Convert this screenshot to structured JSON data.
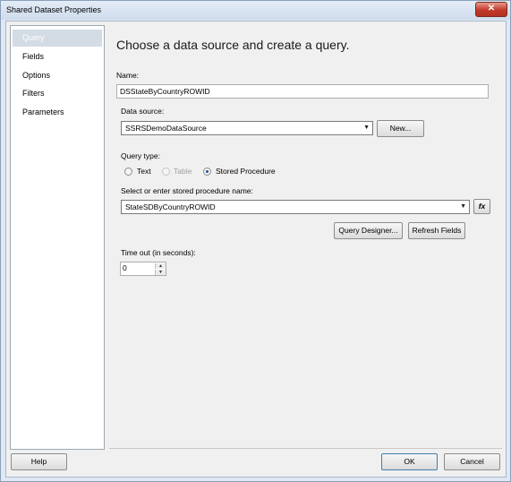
{
  "window": {
    "title": "Shared Dataset Properties",
    "close_glyph": "✕"
  },
  "sidebar": {
    "items": [
      {
        "label": "Query",
        "active": true
      },
      {
        "label": "Fields"
      },
      {
        "label": "Options"
      },
      {
        "label": "Filters"
      },
      {
        "label": "Parameters"
      }
    ]
  },
  "main": {
    "heading": "Choose a data source and create a query.",
    "name_label": "Name:",
    "name_value": "DSStateByCountryROWID",
    "datasource_label": "Data source:",
    "datasource_value": "SSRSDemoDataSource",
    "new_button": "New...",
    "querytype_label": "Query type:",
    "querytype_options": [
      "Text",
      "Table",
      "Stored Procedure"
    ],
    "querytype_selected": "Stored Procedure",
    "sp_label": "Select or enter stored procedure name:",
    "sp_value": "StateSDByCountryROWID",
    "fx_button": "fx",
    "query_designer_button": "Query Designer...",
    "refresh_fields_button": "Refresh Fields",
    "timeout_label": "Time out (in seconds):",
    "timeout_value": "0"
  },
  "footer": {
    "help_button": "Help",
    "ok_button": "OK",
    "cancel_button": "Cancel"
  }
}
